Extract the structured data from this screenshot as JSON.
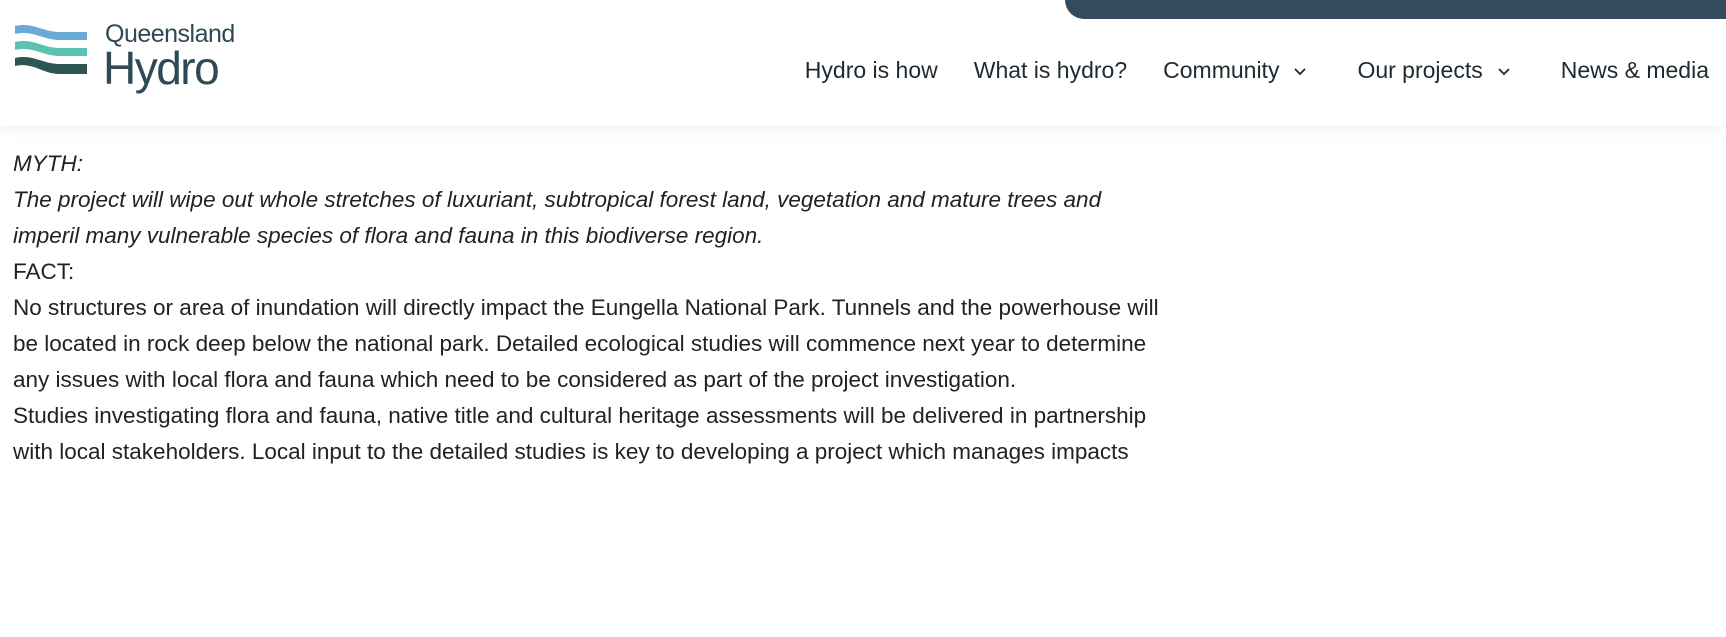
{
  "logo": {
    "line1": "Queensland",
    "line2": "Hydro",
    "colors": {
      "blue": "#6aa8d6",
      "teal": "#5cc2b0",
      "dark": "#2f5552"
    }
  },
  "nav": {
    "items": [
      {
        "label": "Hydro is how"
      },
      {
        "label": "What is hydro?"
      },
      {
        "label": "Community",
        "dropdown_icon": "chevron-down-icon"
      },
      {
        "label": "Our projects",
        "dropdown_icon": "chevron-down-icon"
      },
      {
        "label": "News & media"
      }
    ]
  },
  "content": {
    "myth_label": "MYTH:",
    "myth_text": "The project will wipe out whole stretches of luxuriant, subtropical forest land, vegetation and mature trees and imperil many vulnerable species of flora and fauna in this biodiverse region.",
    "fact_label": "FACT:",
    "fact_paragraph_1": "No structures or area of inundation will directly impact the Eungella National Park. Tunnels and the powerhouse will be located in rock deep below the national park. Detailed ecological studies will commence next year to determine any issues with local flora and fauna which need to be considered as part of the project investigation.",
    "fact_paragraph_2": "Studies investigating flora and fauna, native title and cultural heritage assessments will be delivered in partnership with local stakeholders. Local input to the detailed studies is key to developing a project which manages impacts"
  },
  "colors": {
    "header_band": "#344a5e",
    "text": "#222222"
  }
}
